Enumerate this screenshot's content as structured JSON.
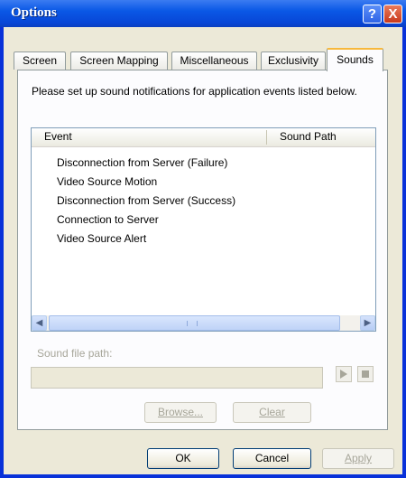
{
  "window": {
    "title": "Options"
  },
  "titlebar": {
    "help": "?",
    "close": "X"
  },
  "tabs": [
    {
      "label": "Screen",
      "active": false
    },
    {
      "label": "Screen Mapping",
      "active": false
    },
    {
      "label": "Miscellaneous",
      "active": false
    },
    {
      "label": "Exclusivity",
      "active": false
    },
    {
      "label": "Sounds",
      "active": true
    }
  ],
  "sounds": {
    "description": "Please set up sound notifications for application events listed below.",
    "columns": [
      "Event",
      "Sound Path"
    ],
    "events": [
      "Disconnection from Server (Failure)",
      "Video Source Motion",
      "Disconnection from Server (Success)",
      "Connection to Server",
      "Video Source Alert"
    ],
    "sound_file_label": "Sound file path:",
    "sound_file_value": "",
    "browse_label": "Browse...",
    "clear_label": "Clear"
  },
  "footer": {
    "ok": "OK",
    "cancel": "Cancel",
    "apply": "Apply"
  },
  "colors": {
    "titlebar": "#0a58e6",
    "border": "#0831d9",
    "dialog_bg": "#ece9d8",
    "active_tab_accent": "#f7b83c",
    "disabled_text": "#a7a69a"
  },
  "icons": {
    "scroll_left": "arrow-left-icon",
    "scroll_right": "arrow-right-icon",
    "play": "play-icon",
    "stop": "stop-icon"
  }
}
